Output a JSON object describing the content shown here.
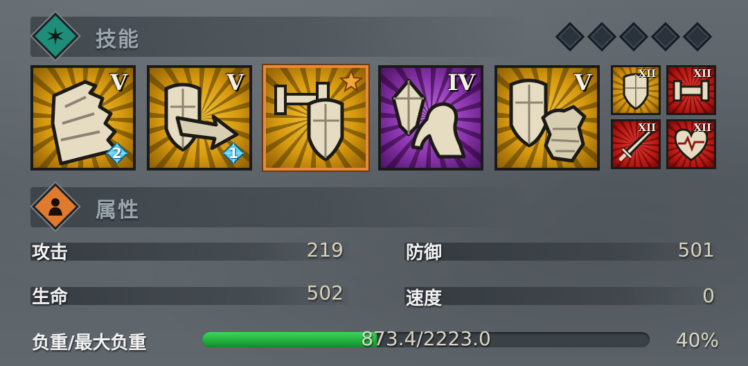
{
  "skills_section": {
    "title": "技能",
    "icon": "compass-star-icon",
    "rank_diamonds": 5
  },
  "skills": [
    {
      "icon": "crumbling-wall-icon",
      "level": "V",
      "gem_count": "2",
      "frame": "gold"
    },
    {
      "icon": "shield-bash-icon",
      "level": "V",
      "gem_count": "1",
      "frame": "gold"
    },
    {
      "icon": "dumbbell-shield-icon",
      "level": "",
      "starred": true,
      "frame": "gold",
      "selected": true
    },
    {
      "icon": "crystal-strength-icon",
      "level": "IV",
      "frame": "purple"
    },
    {
      "icon": "shield-armor-icon",
      "level": "V",
      "frame": "gold"
    }
  ],
  "mini_skills": [
    {
      "icon": "shield-icon",
      "level": "XII",
      "frame": "gold"
    },
    {
      "icon": "dumbbell-icon",
      "level": "XII",
      "frame": "red"
    },
    {
      "icon": "sword-icon",
      "level": "XII",
      "frame": "red"
    },
    {
      "icon": "heartbeat-icon",
      "level": "XII",
      "frame": "red"
    }
  ],
  "attributes_section": {
    "title": "属性",
    "icon": "person-icon"
  },
  "attributes": {
    "attack": {
      "label": "攻击",
      "value": "219"
    },
    "defense": {
      "label": "防御",
      "value": "501"
    },
    "health": {
      "label": "生命",
      "value": "502"
    },
    "speed": {
      "label": "速度",
      "value": "0"
    }
  },
  "weight": {
    "label": "负重/最大负重",
    "text": "873.4/2223.0",
    "percent_text": "40%",
    "fill_fraction": 0.39
  },
  "colors": {
    "skill_icon_bg": "#1f8e78",
    "attr_icon_bg": "#e07a2e",
    "selected_border": "#e58a3a",
    "weight_fill": "#1fae3a"
  }
}
